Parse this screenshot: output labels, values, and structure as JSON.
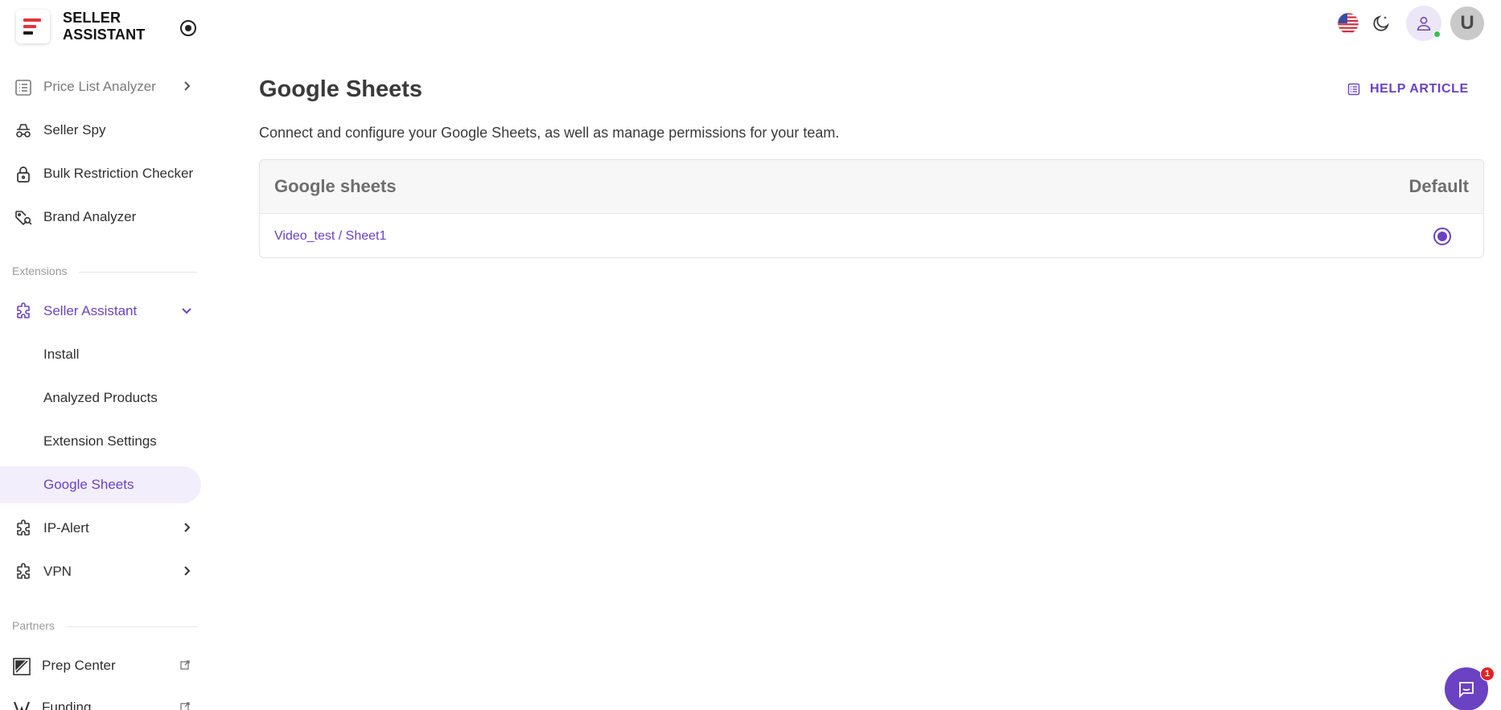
{
  "brand": {
    "line1": "SELLER",
    "line2": "ASSISTANT",
    "logo_colors": [
      "#e8343d",
      "#e8343d",
      "#1b1b1b"
    ]
  },
  "sidebar": {
    "items": [
      {
        "label": "Price List Analyzer",
        "icon": "list-icon",
        "has_chevron": true
      },
      {
        "label": "Seller Spy",
        "icon": "spy-icon"
      },
      {
        "label": "Bulk Restriction Checker",
        "icon": "lock-icon"
      },
      {
        "label": "Brand Analyzer",
        "icon": "tag-search-icon"
      }
    ],
    "section_extensions": "Extensions",
    "extension_group": {
      "label": "Seller Assistant",
      "icon": "puzzle-icon",
      "expanded": true
    },
    "sub_items": [
      {
        "label": "Install"
      },
      {
        "label": "Analyzed Products"
      },
      {
        "label": "Extension Settings"
      },
      {
        "label": "Google Sheets",
        "active": true
      }
    ],
    "more_extensions": [
      {
        "label": "IP-Alert",
        "icon": "puzzle-icon"
      },
      {
        "label": "VPN",
        "icon": "puzzle-icon"
      }
    ],
    "section_partners": "Partners",
    "partners": [
      {
        "label": "Prep Center",
        "icon": "prep-center-icon"
      },
      {
        "label": "Funding",
        "icon": "funding-icon"
      }
    ]
  },
  "topbar": {
    "language_icon": "us-flag-icon",
    "theme_icon": "moon-icon",
    "user_icon": "user-icon",
    "avatar_letter": "U",
    "status": "online"
  },
  "main": {
    "title": "Google Sheets",
    "help_label": "HELP ARTICLE",
    "subtitle": "Connect and configure your Google Sheets, as well as manage permissions for your team.",
    "table": {
      "headers": [
        "Google sheets",
        "Default"
      ],
      "rows": [
        {
          "sheet": "Video_test / Sheet1",
          "default": true
        }
      ]
    }
  },
  "chat": {
    "badge": "1"
  },
  "colors": {
    "accent": "#6a42c2",
    "active_bg": "#f3eefb",
    "online": "#3ac04a",
    "badge": "#e02424"
  }
}
